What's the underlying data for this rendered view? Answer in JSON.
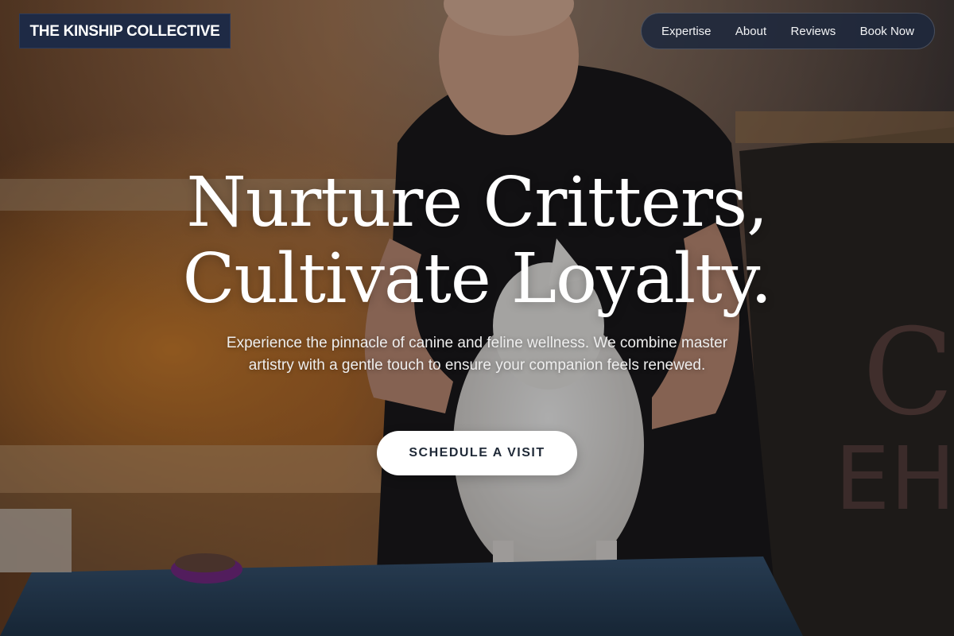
{
  "brand": {
    "name": "THE KINSHIP COLLECTIVE"
  },
  "nav": {
    "items": [
      {
        "label": "Expertise"
      },
      {
        "label": "About"
      },
      {
        "label": "Reviews"
      },
      {
        "label": "Book Now"
      }
    ]
  },
  "hero": {
    "headline_line1": "Nurture Critters,",
    "headline_line2": "Cultivate Loyalty.",
    "subtitle": "Experience the pinnacle of canine and feline wellness. We combine master artistry with a gentle touch to ensure your companion feels renewed.",
    "cta_label": "SCHEDULE A VISIT"
  },
  "colors": {
    "brand_bg": "#1e2a45",
    "nav_bg": "#1e283c",
    "cta_bg": "#ffffff",
    "cta_text": "#1f2937",
    "text_light": "#ffffff"
  }
}
